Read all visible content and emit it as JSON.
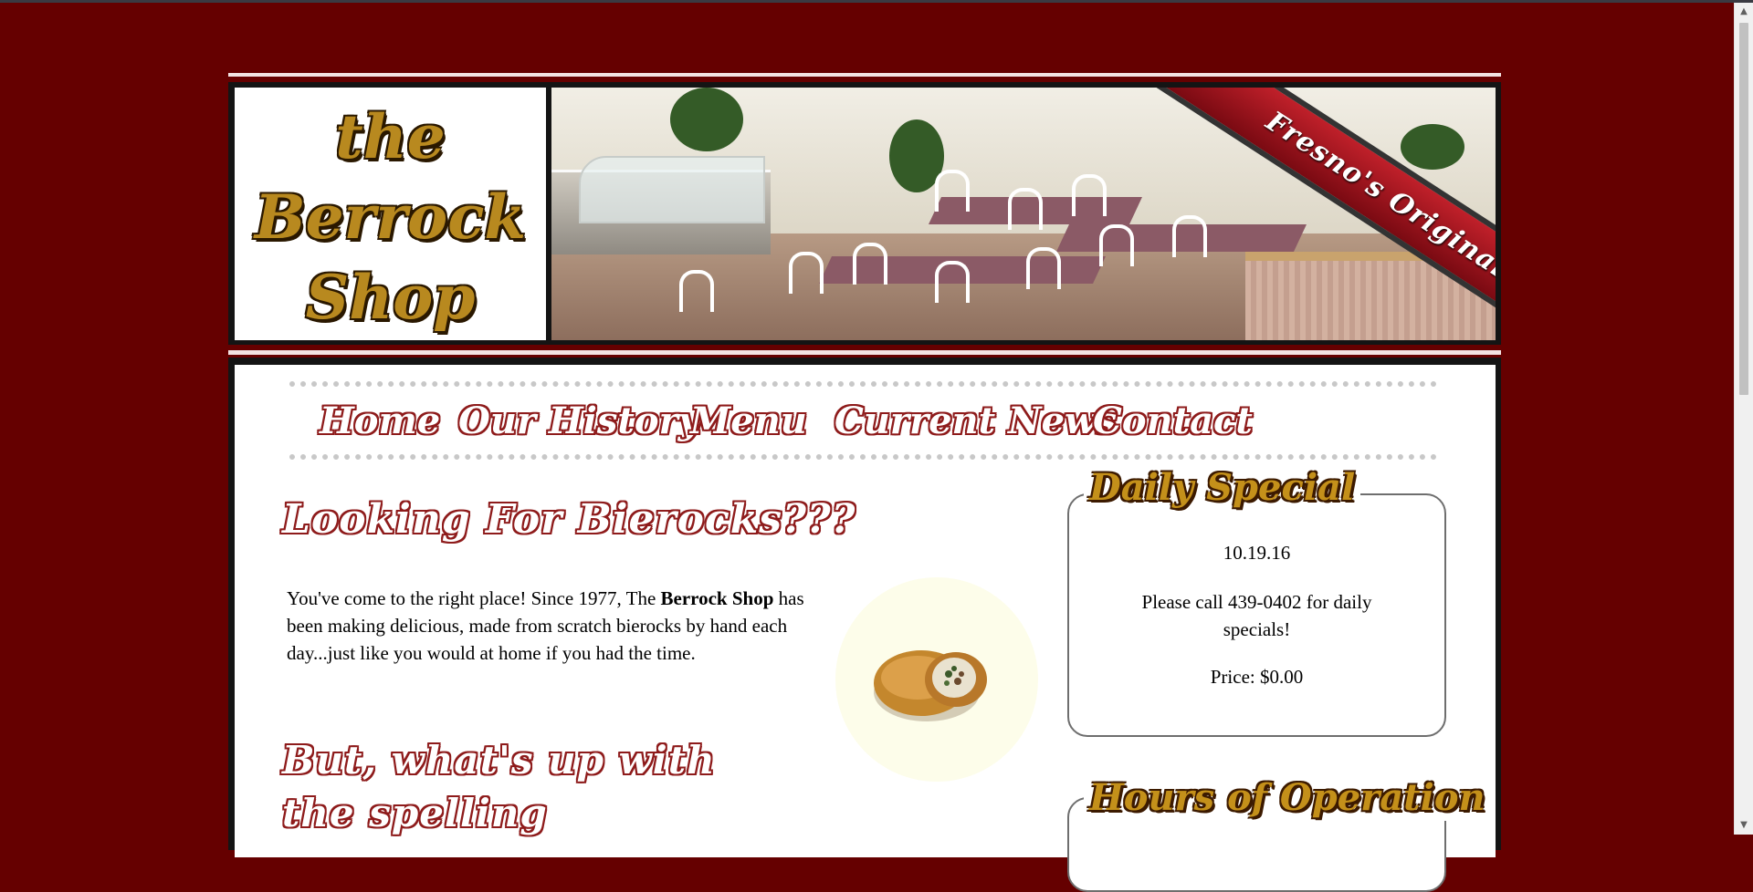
{
  "colors": {
    "background": "#650000",
    "accent_red": "#8e1b1b",
    "gold": "#c4901a"
  },
  "logo": {
    "line1": "the",
    "line2": "Berrock",
    "line3": "Shop"
  },
  "banner": {
    "text": "Fresno's Original"
  },
  "nav": {
    "items": [
      "Home",
      "Our History",
      "Menu",
      "Current News",
      "Contact"
    ]
  },
  "main": {
    "heading": "Looking For Bierocks???",
    "intro_before": "You've come to the right place! Since 1977, The ",
    "intro_bold": "Berrock Shop",
    "intro_after": " has been making delicious, made from scratch bierocks by hand each day...just like you would at home if you had the time.",
    "heading2": "But, what's up with the spelling"
  },
  "daily_special": {
    "title": "Daily Special",
    "date": "10.19.16",
    "message": "Please call 439-0402 for daily specials!",
    "price": "Price: $0.00"
  },
  "hours": {
    "title": "Hours of Operation"
  },
  "icons": {
    "scroll_up": "chevron-up-icon",
    "scroll_down": "chevron-down-icon"
  }
}
